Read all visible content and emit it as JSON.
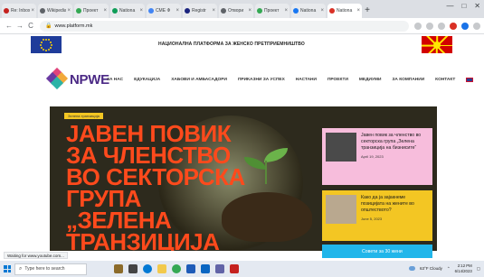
{
  "browser": {
    "tabs": [
      {
        "label": "Re: Inbox (1)",
        "color": "#c5221f"
      },
      {
        "label": "Wikipedia",
        "color": "#5f6368"
      },
      {
        "label": "Проект",
        "color": "#34a853"
      },
      {
        "label": "Nationa",
        "color": "#0f9d58"
      },
      {
        "label": "СМЕ Ф",
        "color": "#4285f4"
      },
      {
        "label": "Registr",
        "color": "#1a237e"
      },
      {
        "label": "Отвори",
        "color": "#5f6368"
      },
      {
        "label": "Проект",
        "color": "#34a853"
      },
      {
        "label": "Nationa",
        "color": "#1877f2"
      },
      {
        "label": "Nationa",
        "color": "#d93025"
      }
    ],
    "tab_close": "×",
    "new_tab": "+",
    "window_controls": {
      "minimize": "—",
      "maximize": "□",
      "close": "✕"
    },
    "back": "←",
    "forward": "→",
    "reload": "C",
    "url": "www.platform.mk"
  },
  "site": {
    "banner_title": "НАЦИОНАЛНА ПЛАТФОРМА ЗА ЖЕНСКО ПРЕТПРИЕМНИШТВО",
    "logo_text": "NPWE",
    "nav": [
      "ЗА НАС",
      "ЕДУКАЦИЈА",
      "ХАБОВИ И АМБАСАДОРИ",
      "ПРИКАЗНИ ЗА УСПЕХ",
      "НАСТАНИ",
      "ПРОЕКТИ",
      "МЕДИУМИ",
      "ЗА КОМПАНИИ",
      "КОНТАКТ"
    ]
  },
  "hero": {
    "tag": "Зелена транзиција",
    "title": "Јавен повик за членство во секторска група „Зелена транзиција на"
  },
  "cards": [
    {
      "text": "Јавен повик за членство во секторска група „Зелена транзиција на бизнисите“",
      "date": "April 19, 2023"
    },
    {
      "text": "Како да ја зајакнеме позицијата на жените во општеството?",
      "date": "June 5, 2023"
    },
    {
      "text": "Совети за 30 жени",
      "date": ""
    }
  ],
  "status_text": "Waiting for www.youtube.com...",
  "taskbar": {
    "search_placeholder": "Type here to search",
    "weather": "63°F Cloudy",
    "time": "2:12 PM",
    "date": "6/14/2023"
  }
}
